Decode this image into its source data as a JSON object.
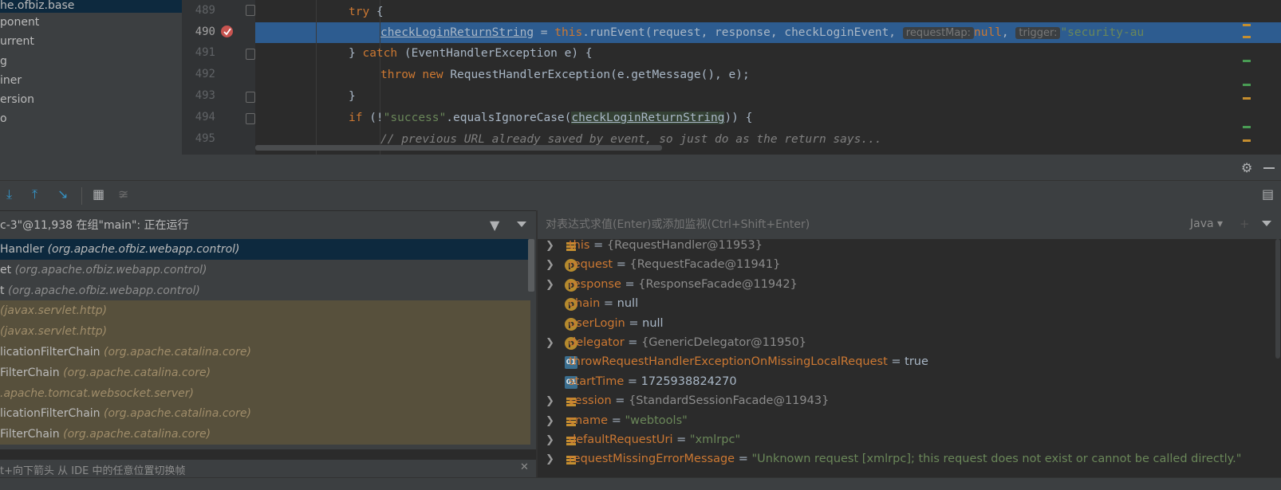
{
  "project_tree": {
    "items": [
      "he.ofbiz.base",
      "ponent",
      "urrent",
      "g",
      "iner",
      "ersion",
      "o"
    ]
  },
  "editor": {
    "line_numbers": [
      "489",
      "490",
      "491",
      "492",
      "493",
      "494",
      "495"
    ],
    "lines": {
      "l489_kw": "try",
      "l489_rest": " {",
      "l490_var": "checkLoginReturnString",
      "l490_mid": " = ",
      "l490_this": "this",
      "l490_call": ".runEvent(request, response, checkLoginEvent, ",
      "l490_hint1": "requestMap:",
      "l490_null": "null",
      "l490_comma": ", ",
      "l490_hint2": "trigger:",
      "l490_str": "\"security-au",
      "l491_pre": "} ",
      "l491_kw": "catch",
      "l491_rest": " (EventHandlerException e) {",
      "l492_kw1": "throw",
      "l492_kw2": "new",
      "l492_rest": " RequestHandlerException(e.getMessage(), e);",
      "l493": "}",
      "l494_kw": "if",
      "l494_a": " (!",
      "l494_str": "\"success\"",
      "l494_b": ".equalsIgnoreCase(",
      "l494_var": "checkLoginReturnString",
      "l494_c": ")) {",
      "l495_comment": "// previous URL already saved by event, so just do as the return says..."
    }
  },
  "debugger": {
    "thread_label": "c-3\"@11,938 在组\"main\": 正在运行",
    "eval_placeholder": "对表达式求值(Enter)或添加监视(Ctrl+Shift+Enter)",
    "language": "Java",
    "frames": [
      {
        "name": "Handler ",
        "pkg": "(org.apache.ofbiz.webapp.control)",
        "kind": "selected"
      },
      {
        "name": "et ",
        "pkg": "(org.apache.ofbiz.webapp.control)",
        "kind": "app"
      },
      {
        "name": "t ",
        "pkg": "(org.apache.ofbiz.webapp.control)",
        "kind": "app"
      },
      {
        "name": "",
        "pkg": "(javax.servlet.http)",
        "kind": "lib"
      },
      {
        "name": "",
        "pkg": "(javax.servlet.http)",
        "kind": "lib"
      },
      {
        "name": "licationFilterChain ",
        "pkg": "(org.apache.catalina.core)",
        "kind": "lib"
      },
      {
        "name": "FilterChain ",
        "pkg": "(org.apache.catalina.core)",
        "kind": "lib"
      },
      {
        "name": "",
        "pkg": ".apache.tomcat.websocket.server)",
        "kind": "lib"
      },
      {
        "name": "licationFilterChain ",
        "pkg": "(org.apache.catalina.core)",
        "kind": "lib"
      },
      {
        "name": "FilterChain ",
        "pkg": "(org.apache.catalina.core)",
        "kind": "lib"
      }
    ],
    "frames_tip": "t+向下箭头 从 IDE 中的任意位置切换帧",
    "variables": [
      {
        "name": "this",
        "value": "{RequestHandler@11953}",
        "vtype": "ref",
        "icon": "list",
        "expand": true
      },
      {
        "name": "request",
        "value": "{RequestFacade@11941}",
        "vtype": "ref",
        "icon": "param",
        "expand": true
      },
      {
        "name": "response",
        "value": "{ResponseFacade@11942}",
        "vtype": "ref",
        "icon": "param",
        "expand": true
      },
      {
        "name": "chain",
        "value": "null",
        "vtype": "prim",
        "icon": "param",
        "expand": false
      },
      {
        "name": "userLogin",
        "value": "null",
        "vtype": "prim",
        "icon": "param",
        "expand": false
      },
      {
        "name": "delegator",
        "value": "{GenericDelegator@11950}",
        "vtype": "ref",
        "icon": "param",
        "expand": true
      },
      {
        "name": "throwRequestHandlerExceptionOnMissingLocalRequest",
        "value": "true",
        "vtype": "prim",
        "icon": "field",
        "expand": false
      },
      {
        "name": "startTime",
        "value": "1725938824270",
        "vtype": "prim",
        "icon": "field",
        "expand": false
      },
      {
        "name": "session",
        "value": "{StandardSessionFacade@11943}",
        "vtype": "ref",
        "icon": "list",
        "expand": true
      },
      {
        "name": "cname",
        "value": "\"webtools\"",
        "vtype": "str",
        "icon": "list",
        "expand": true
      },
      {
        "name": "defaultRequestUri",
        "value": "\"xmlrpc\"",
        "vtype": "str",
        "icon": "list",
        "expand": true
      },
      {
        "name": "requestMissingErrorMessage",
        "value": "\"Unknown request [xmlrpc]; this request does not exist or cannot be called directly.\"",
        "vtype": "str",
        "icon": "list",
        "expand": true
      }
    ]
  },
  "colors": {
    "current_line": "#2d5c90",
    "keyword": "#cc7832",
    "string": "#6a8759",
    "library_frame": "#57503c",
    "selected_frame": "#0d293e"
  }
}
